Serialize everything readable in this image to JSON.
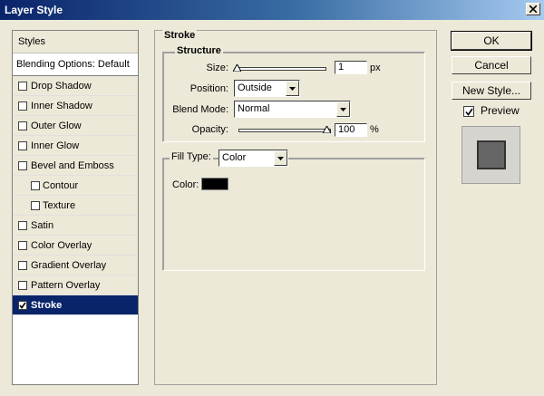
{
  "window": {
    "title": "Layer Style"
  },
  "sidebar": {
    "header": "Styles",
    "blending_options": "Blending Options: Default",
    "items": [
      {
        "label": "Drop Shadow",
        "checked": false
      },
      {
        "label": "Inner Shadow",
        "checked": false
      },
      {
        "label": "Outer Glow",
        "checked": false
      },
      {
        "label": "Inner Glow",
        "checked": false
      },
      {
        "label": "Bevel and Emboss",
        "checked": false
      },
      {
        "label": "Contour",
        "checked": false
      },
      {
        "label": "Texture",
        "checked": false
      },
      {
        "label": "Satin",
        "checked": false
      },
      {
        "label": "Color Overlay",
        "checked": false
      },
      {
        "label": "Gradient Overlay",
        "checked": false
      },
      {
        "label": "Pattern Overlay",
        "checked": false
      },
      {
        "label": "Stroke",
        "checked": true
      }
    ]
  },
  "stroke": {
    "title": "Stroke",
    "structure": {
      "title": "Structure",
      "size_label": "Size:",
      "size_value": "1",
      "size_unit": "px",
      "position_label": "Position:",
      "position_value": "Outside",
      "blend_mode_label": "Blend Mode:",
      "blend_mode_value": "Normal",
      "opacity_label": "Opacity:",
      "opacity_value": "100",
      "opacity_unit": "%"
    },
    "fill": {
      "fill_type_label": "Fill Type:",
      "fill_type_value": "Color",
      "color_label": "Color:",
      "color_value": "#000000"
    }
  },
  "buttons": {
    "ok": "OK",
    "cancel": "Cancel",
    "new_style": "New Style...",
    "preview_label": "Preview"
  }
}
